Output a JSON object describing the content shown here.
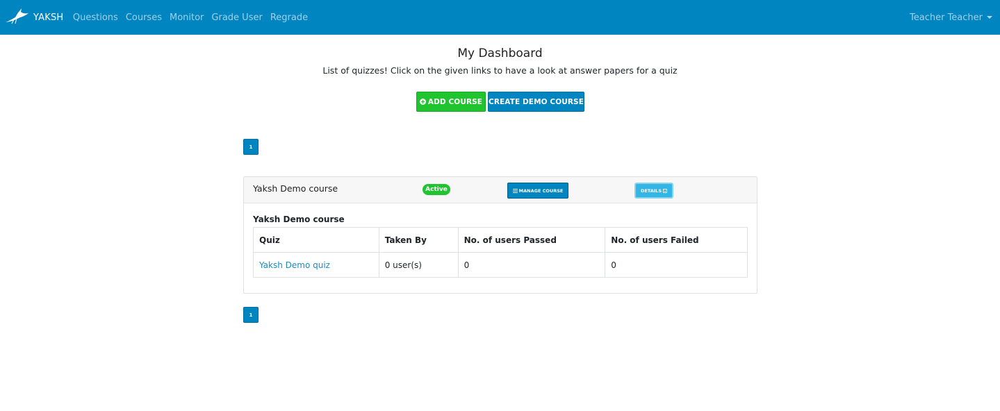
{
  "navbar": {
    "brand": "YAKSH",
    "links": [
      "Questions",
      "Courses",
      "Monitor",
      "Grade User",
      "Regrade"
    ],
    "user": "Teacher Teacher"
  },
  "header": {
    "title": "My Dashboard",
    "subtitle": "List of quizzes! Click on the given links to have a look at answer papers for a quiz"
  },
  "actions": {
    "add_course": "ADD COURSE",
    "create_demo": "CREATE DEMO COURSE"
  },
  "pagination": {
    "current": "1"
  },
  "course": {
    "name": "Yaksh Demo course",
    "status": "Active",
    "manage_label": "MANAGE COURSE",
    "details_label": "DETAILS",
    "section_title": "Yaksh Demo course",
    "table": {
      "headers": [
        "Quiz",
        "Taken By",
        "No. of users Passed",
        "No. of users Failed"
      ],
      "rows": [
        [
          "Yaksh Demo quiz",
          "0 user(s)",
          "0",
          "0"
        ]
      ]
    }
  },
  "colors": {
    "navbar": "#0085c1",
    "success": "#1fc42f",
    "info": "#33b5e5"
  }
}
